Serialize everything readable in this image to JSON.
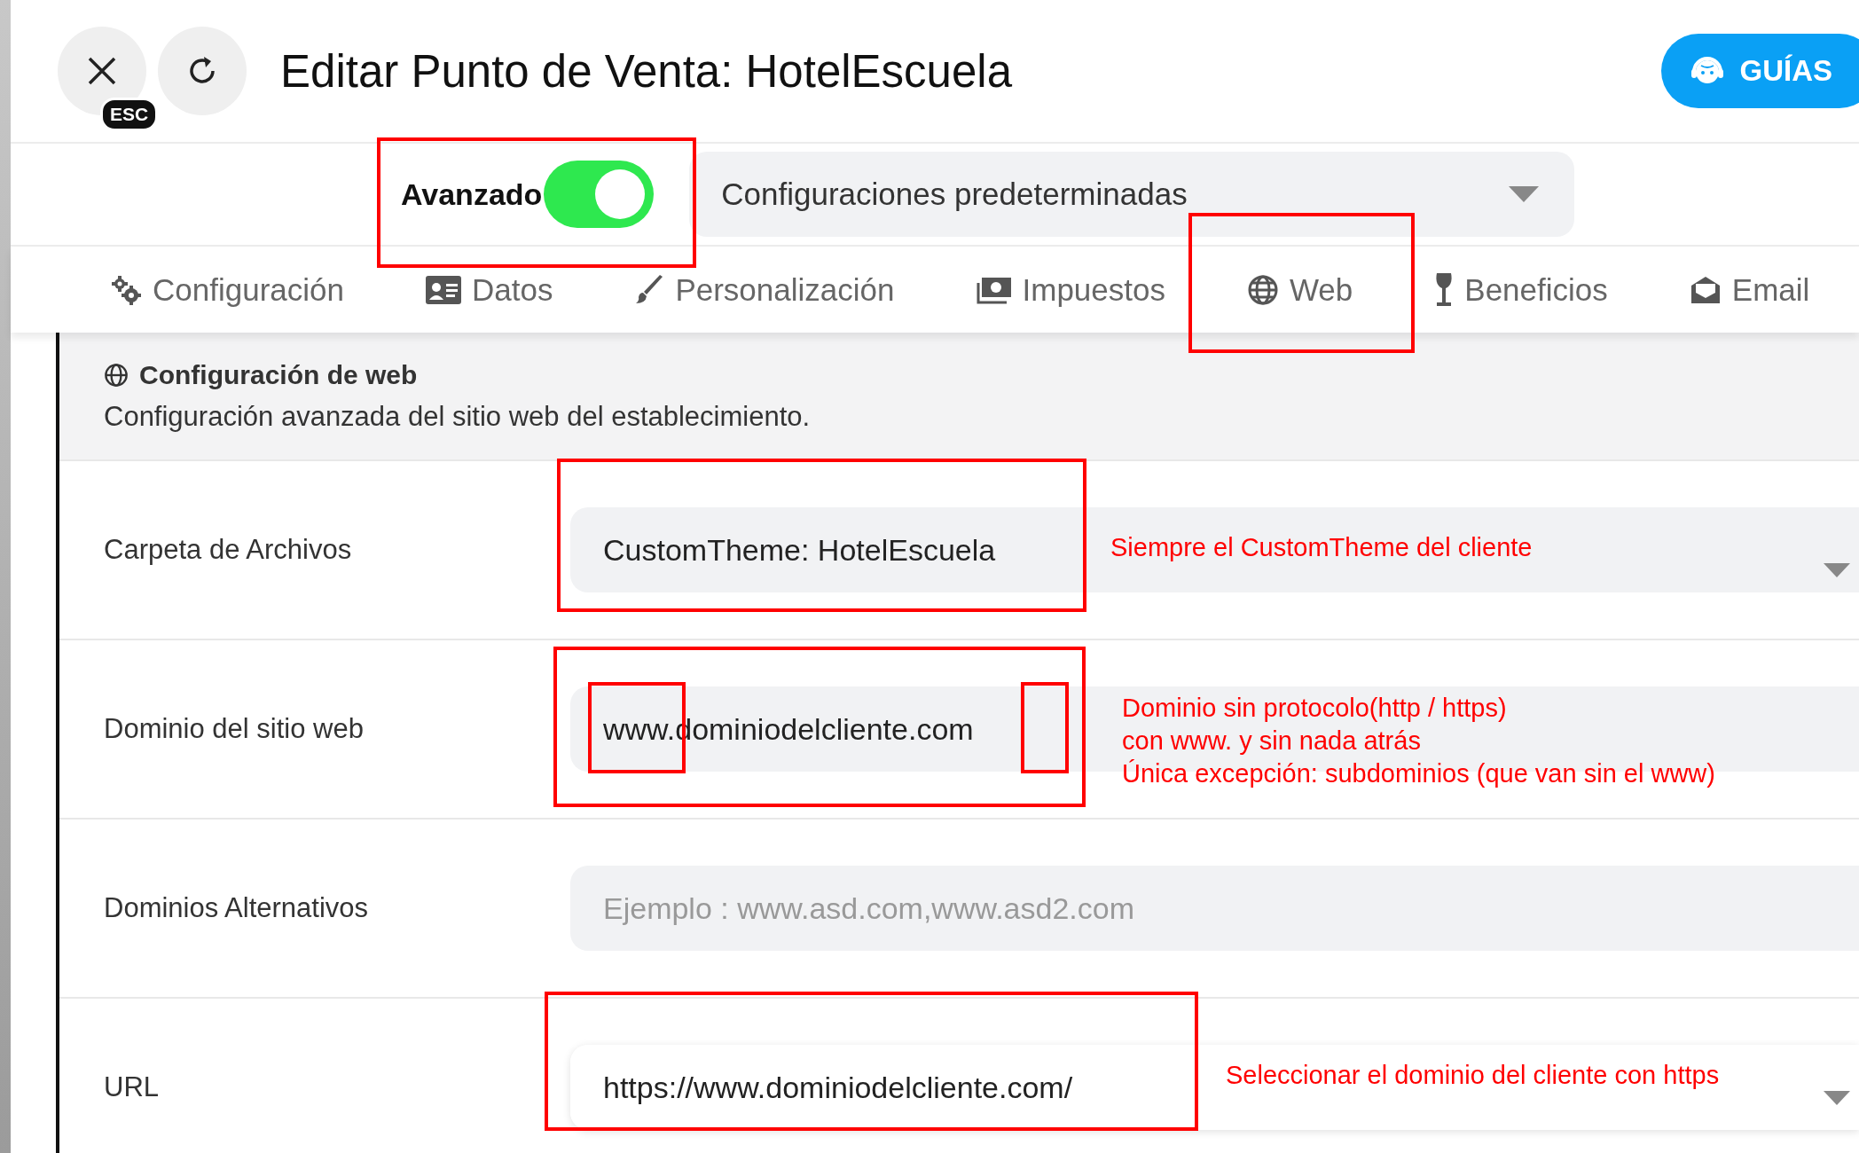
{
  "header": {
    "esc_badge": "ESC",
    "title": "Editar Punto de Venta: HotelEscuela",
    "guides_button": "GUÍAS"
  },
  "advanced": {
    "label": "Avanzado",
    "on": true
  },
  "preset_select": {
    "value": "Configuraciones predeterminadas"
  },
  "tabs": [
    {
      "label": "Configuración"
    },
    {
      "label": "Datos"
    },
    {
      "label": "Personalización"
    },
    {
      "label": "Impuestos"
    },
    {
      "label": "Web"
    },
    {
      "label": "Beneficios"
    },
    {
      "label": "Email"
    }
  ],
  "section": {
    "heading": "Configuración de web",
    "description": "Configuración avanzada del sitio web del establecimiento."
  },
  "fields": [
    {
      "label": "Carpeta de Archivos",
      "kind": "select",
      "value": "CustomTheme: HotelEscuela",
      "note": [
        "Siempre el CustomTheme del cliente"
      ]
    },
    {
      "label": "Dominio del sitio web",
      "kind": "text",
      "value": "www.dominiodelcliente.com",
      "note": [
        "Dominio sin protocolo(http / https)",
        "con www. y sin nada atrás",
        "Única excepción: subdominios (que van sin el www)"
      ]
    },
    {
      "label": "Dominios Alternativos",
      "kind": "text",
      "placeholder": "Ejemplo : www.asd.com,www.asd2.com"
    },
    {
      "label": "URL",
      "kind": "open-select",
      "value": "https://www.dominiodelcliente.com/",
      "note": [
        "Seleccionar el dominio del cliente con https"
      ]
    }
  ]
}
